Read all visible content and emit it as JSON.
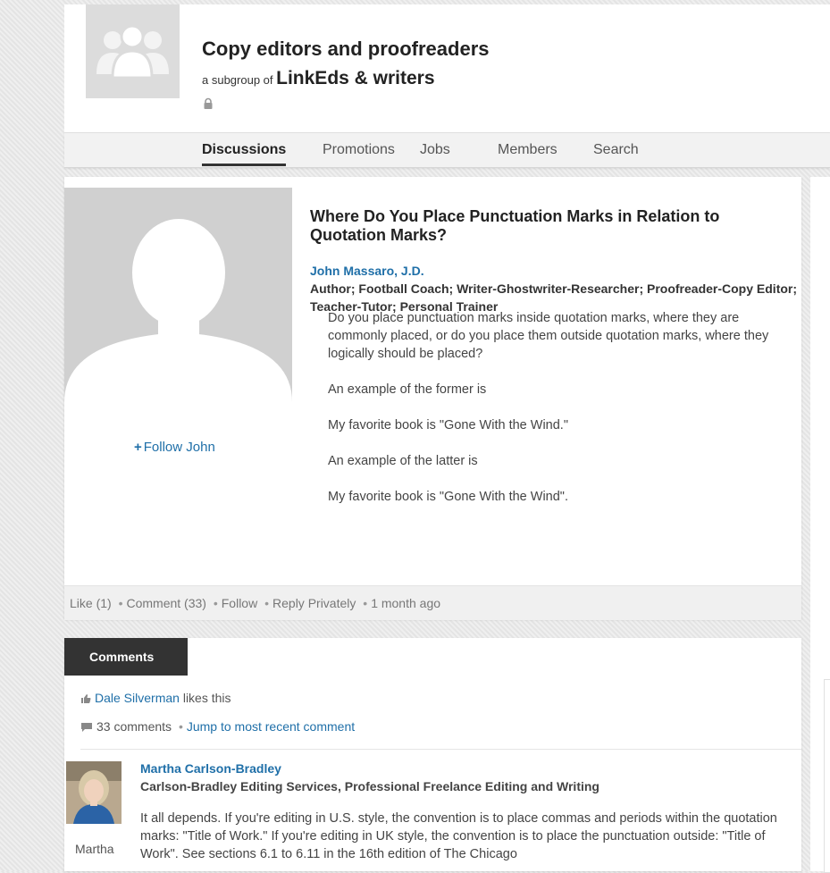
{
  "group": {
    "title": "Copy editors and proofreaders",
    "subgroup_prefix": "a subgroup of",
    "parent_group": "LinkEds & writers"
  },
  "nav": {
    "tabs": [
      {
        "label": "Discussions",
        "active": true
      },
      {
        "label": "Promotions"
      },
      {
        "label": "Jobs"
      },
      {
        "label": "Members"
      },
      {
        "label": "Search"
      }
    ]
  },
  "post": {
    "title": "Where Do You Place Punctuation Marks in Relation to Quotation Marks?",
    "author_name": "John Massaro, J.D.",
    "author_headline": "Author; Football Coach; Writer-Ghostwriter-Researcher; Proofreader-Copy Editor; Teacher-Tutor; Personal Trainer",
    "follow_label": "Follow John",
    "body": [
      "Do you place punctuation marks inside quotation marks, where they are commonly placed, or do you place them outside quotation marks, where they logically should be placed?",
      "An example of the former is",
      "My favorite book is \"Gone With the Wind.\"",
      "An example of the latter is",
      "My favorite book is \"Gone With the Wind\"."
    ],
    "footer": {
      "like": "Like (1)",
      "comment": "Comment (33)",
      "follow": "Follow",
      "reply": "Reply Privately",
      "time": "1 month ago"
    }
  },
  "comments": {
    "tab_label": "Comments",
    "liker_name": "Dale Silverman",
    "likes_suffix": "likes this",
    "count_label": "33 comments",
    "jump_label": "Jump to most recent comment",
    "items": [
      {
        "name": "Martha Carlson-Bradley",
        "headline": "Carlson-Bradley Editing Services, Professional Freelance Editing and Writing",
        "first_name": "Martha",
        "text": "It all depends. If you're editing in U.S. style, the convention is to place commas and periods within the quotation marks: \"Title of Work.\" If you're editing in UK style, the convention is to place the punctuation outside: \"Title of Work\". See sections 6.1 to 6.11 in the 16th edition of The Chicago"
      }
    ]
  },
  "colors": {
    "link": "#1f6fa8",
    "tab_dark": "#333333",
    "placeholder_gray": "#d0d0d0"
  },
  "icons": [
    "group-people-icon",
    "lock-icon",
    "plus-icon",
    "thumbs-up-icon",
    "comment-bubble-icon"
  ]
}
